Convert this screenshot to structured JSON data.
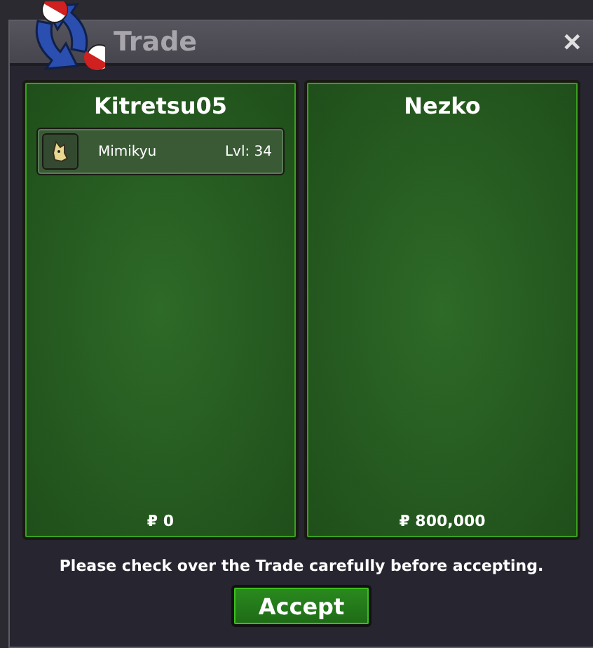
{
  "window": {
    "title": "Trade",
    "close": "✕"
  },
  "panels": [
    {
      "player": "Kitretsu05",
      "items": [
        {
          "name": "Mimikyu",
          "level": "Lvl: 34"
        }
      ],
      "money": "₽ 0"
    },
    {
      "player": "Nezko",
      "money": "₽ 800,000"
    }
  ],
  "message": "Please check over the Trade carefully before accepting.",
  "accept_button": "Accept"
}
